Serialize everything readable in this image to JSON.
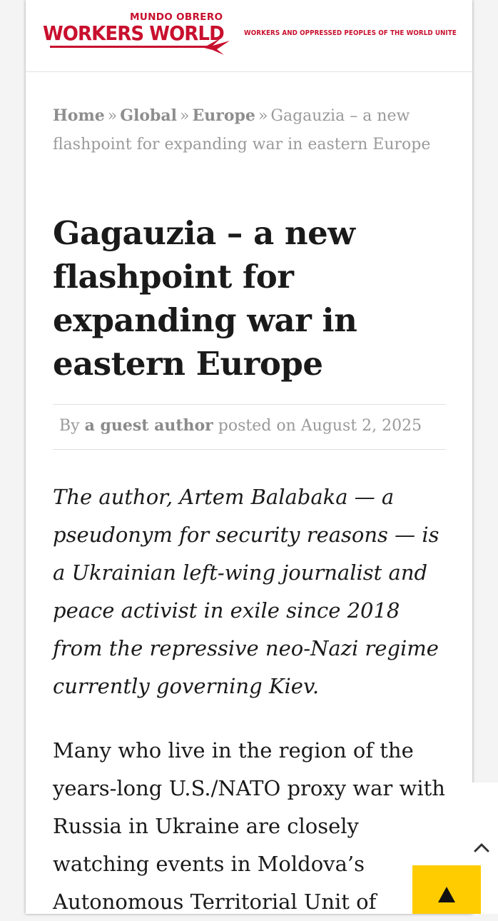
{
  "site": {
    "brand_top": "MUNDO OBRERO",
    "brand_main": "WORKERS WORLD",
    "tagline": "WORKERS AND OPPRESSED PEOPLES OF THE WORLD UNITE",
    "brand_color": "#c8102e"
  },
  "breadcrumb": {
    "items": [
      "Home",
      "Global",
      "Europe"
    ],
    "separator": "»",
    "current": "Gagauzia – a new flashpoint for expanding war in eastern Europe"
  },
  "article": {
    "title": "Gagauzia – a new flashpoint for expanding war in eastern Europe",
    "byline_prefix": "By",
    "author": "a guest author",
    "posted_on": "posted on",
    "date": "August 2, 2025",
    "intro": "The author, Artem Balabaka — a pseudonym for security reasons — is a Ukrainian left-wing journalist and peace activist in exile since 2018 from the repressive neo-Nazi regime currently governing Kiev.",
    "paragraph1": "Many who live in the region of the years-long U.S./NATO proxy war with Russia in Ukraine are closely watching events in Moldova’s Autonomous Territorial Unit of"
  },
  "controls": {
    "back_to_top_icon": "chevron-up-icon",
    "scroll_up_icon": "triangle-up-icon",
    "scroll_button_color": "#ffcc00"
  }
}
